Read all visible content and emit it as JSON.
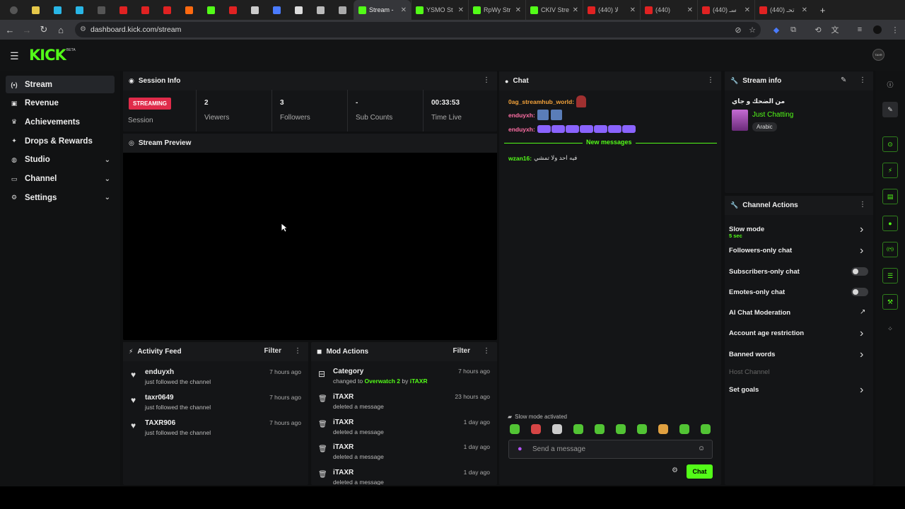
{
  "browser": {
    "tabs": [
      {
        "label": "",
        "icon": "chevron-down-icon",
        "color": "#555"
      },
      {
        "label": "",
        "icon": "yellow-square-icon",
        "color": "#e6c84a"
      },
      {
        "label": "",
        "icon": "w-icon",
        "color": "#29b6e6"
      },
      {
        "label": "",
        "icon": "w-icon",
        "color": "#29b6e6"
      },
      {
        "label": "",
        "icon": "dash-icon",
        "color": "#555"
      },
      {
        "label": "",
        "icon": "youtube-icon",
        "color": "#e02222"
      },
      {
        "label": "",
        "icon": "youtube-icon",
        "color": "#e02222"
      },
      {
        "label": "",
        "icon": "youtube-icon",
        "color": "#e02222"
      },
      {
        "label": "",
        "icon": "soundcloud-icon",
        "color": "#ff6a10"
      },
      {
        "label": "",
        "icon": "kick-icon",
        "color": "#53fc18"
      },
      {
        "label": "",
        "icon": "youtube-icon",
        "color": "#e02222"
      },
      {
        "label": "",
        "icon": "discord-icon",
        "color": "#cccccc"
      },
      {
        "label": "",
        "icon": "blue-circle-icon",
        "color": "#4a7bff"
      },
      {
        "label": "",
        "icon": "white-circle-icon",
        "color": "#dddddd"
      },
      {
        "label": "",
        "icon": "cloud-icon",
        "color": "#bbbbbb"
      },
      {
        "label": "",
        "icon": "grid-icon",
        "color": "#aaaaaa"
      }
    ],
    "big_tabs": [
      {
        "label": "Stream -",
        "icon": "kick-icon",
        "color": "#53fc18",
        "active": true
      },
      {
        "label": "YSMO St",
        "icon": "kick-icon",
        "color": "#53fc18",
        "active": false
      },
      {
        "label": "RpWy Str",
        "icon": "kick-icon",
        "color": "#53fc18",
        "active": false
      },
      {
        "label": "CKIV Stre",
        "icon": "kick-icon",
        "color": "#53fc18",
        "active": false
      },
      {
        "label": "(440) لا",
        "icon": "youtube-icon",
        "color": "#e02222",
        "active": false
      },
      {
        "label": "(440)",
        "icon": "youtube-icon",
        "color": "#e02222",
        "active": false
      },
      {
        "label": "(440) سـ",
        "icon": "youtube-icon",
        "color": "#e02222",
        "active": false
      },
      {
        "label": "(440) تحـ",
        "icon": "youtube-icon",
        "color": "#e02222",
        "active": false
      }
    ],
    "url": "dashboard.kick.com/stream"
  },
  "header": {
    "logo": "KICK",
    "beta": "BETA",
    "avatar": "TAXR"
  },
  "sidebar": {
    "items": [
      {
        "label": "Stream",
        "icon": "stream-icon",
        "active": true,
        "expand": false
      },
      {
        "label": "Revenue",
        "icon": "wallet-icon",
        "active": false,
        "expand": false
      },
      {
        "label": "Achievements",
        "icon": "trophy-icon",
        "active": false,
        "expand": false
      },
      {
        "label": "Drops & Rewards",
        "icon": "gift-icon",
        "active": false,
        "expand": false
      },
      {
        "label": "Studio",
        "icon": "palette-icon",
        "active": false,
        "expand": true
      },
      {
        "label": "Channel",
        "icon": "tv-icon",
        "active": false,
        "expand": true
      },
      {
        "label": "Settings",
        "icon": "gear-icon",
        "active": false,
        "expand": true
      }
    ]
  },
  "session": {
    "title": "Session Info",
    "badge": "STREAMING",
    "badge_label": "Session",
    "stats": [
      {
        "value": "2",
        "label": "Viewers"
      },
      {
        "value": "3",
        "label": "Followers"
      },
      {
        "value": "-",
        "label": "Sub Counts"
      },
      {
        "value": "00:33:53",
        "label": "Time Live"
      }
    ]
  },
  "preview": {
    "title": "Stream Preview"
  },
  "activity": {
    "title": "Activity Feed",
    "filter": "Filter",
    "items": [
      {
        "name": "enduyxh",
        "sub": "just followed the channel",
        "time": "7 hours ago"
      },
      {
        "name": "taxr0649",
        "sub": "just followed the channel",
        "time": "7 hours ago"
      },
      {
        "name": "TAXR906",
        "sub": "just followed the channel",
        "time": "7 hours ago"
      }
    ]
  },
  "mod": {
    "title": "Mod Actions",
    "filter": "Filter",
    "category": {
      "name": "Category",
      "prefix": "changed to",
      "game": "Overwatch 2",
      "by": "by",
      "user": "iTAXR",
      "time": "7 hours ago"
    },
    "items": [
      {
        "name": "iTAXR",
        "sub": "deleted a message",
        "time": "23 hours ago"
      },
      {
        "name": "iTAXR",
        "sub": "deleted a message",
        "time": "1 day ago"
      },
      {
        "name": "iTAXR",
        "sub": "deleted a message",
        "time": "1 day ago"
      },
      {
        "name": "iTAXR",
        "sub": "deleted a message",
        "time": "1 day ago"
      }
    ]
  },
  "chat": {
    "title": "Chat",
    "messages": [
      {
        "user": "0ag_streamhub_world:",
        "color": "#f3a23a",
        "text": ""
      },
      {
        "user": "enduyxh:",
        "color": "#ff6fa5",
        "text": ""
      },
      {
        "user": "enduyxh:",
        "color": "#ff6fa5",
        "text": ""
      }
    ],
    "new_messages": "New messages",
    "after": {
      "user": "wzan16:",
      "color": "#53fc18",
      "text": "فيه احد ولا تمشي"
    },
    "slow_mode": "Slow mode activated",
    "placeholder": "Send a message",
    "send": "Chat"
  },
  "stream_info": {
    "title": "Stream info",
    "stream_title": "من الضحك و جاي",
    "category": "Just Chatting",
    "tag": "Arabic"
  },
  "channel_actions": {
    "title": "Channel Actions",
    "items": [
      {
        "label": "Slow mode",
        "sub": "5 sec",
        "kind": "chevron"
      },
      {
        "label": "Followers-only chat",
        "sub": "",
        "kind": "chevron"
      },
      {
        "label": "Subscribers-only chat",
        "sub": "",
        "kind": "toggle"
      },
      {
        "label": "Emotes-only chat",
        "sub": "",
        "kind": "toggle"
      },
      {
        "label": "AI Chat Moderation",
        "sub": "",
        "kind": "external"
      },
      {
        "label": "Account age restriction",
        "sub": "",
        "kind": "chevron"
      },
      {
        "label": "Banned words",
        "sub": "",
        "kind": "chevron"
      },
      {
        "label": "Host Channel",
        "sub": "",
        "kind": "disabled"
      },
      {
        "label": "Set goals",
        "sub": "",
        "kind": "chevron"
      }
    ]
  },
  "rail": [
    "info-icon",
    "pencil-icon",
    "target-icon",
    "bolt-icon",
    "clipboard-icon",
    "chat-bubble-icon",
    "broadcast-icon",
    "list-icon",
    "wrench-icon",
    "grid-dots-icon"
  ],
  "colors": {
    "accent": "#53fc18",
    "live": "#e02b4a",
    "bg": "#0f1011",
    "panel": "#141517"
  }
}
